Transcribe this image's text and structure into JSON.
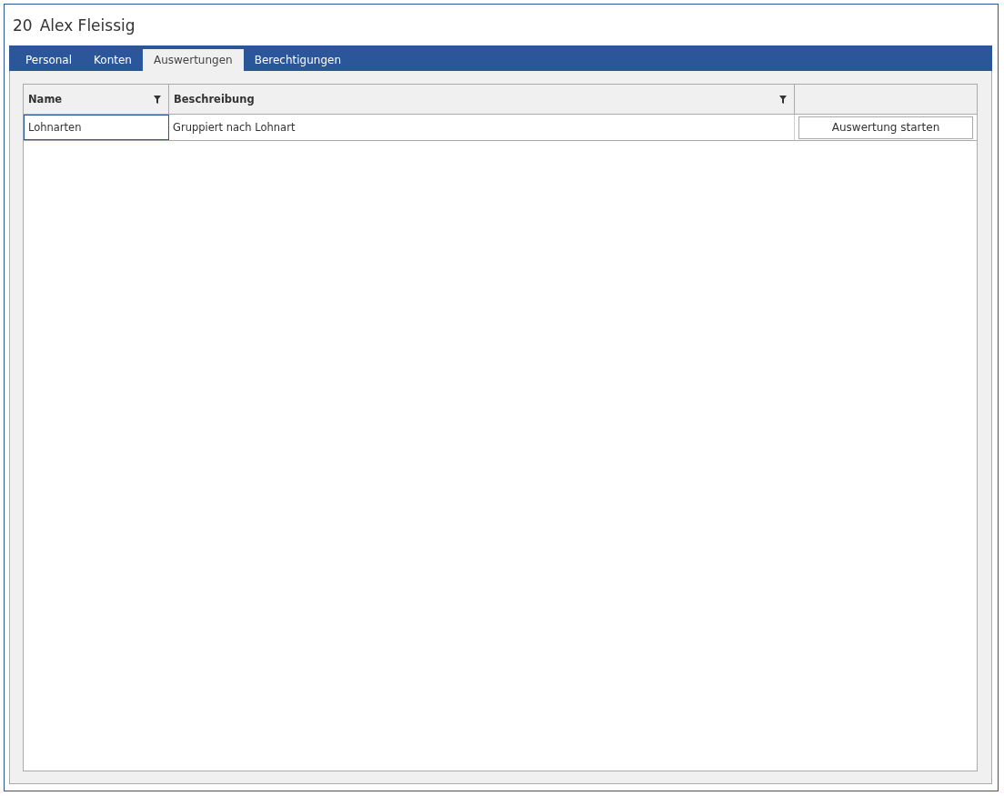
{
  "window": {
    "number": "20",
    "title": "Alex Fleissig"
  },
  "tabs": [
    {
      "label": "Personal",
      "selected": false
    },
    {
      "label": "Konten",
      "selected": false
    },
    {
      "label": "Auswertungen",
      "selected": true
    },
    {
      "label": "Berechtigungen",
      "selected": false
    }
  ],
  "table": {
    "columns": [
      {
        "label": "Name",
        "filter": true
      },
      {
        "label": "Beschreibung",
        "filter": true
      }
    ],
    "rows": [
      {
        "name": "Lohnarten",
        "description": "Gruppiert nach Lohnart",
        "action": "Auswertung starten",
        "focused": true
      }
    ]
  }
}
